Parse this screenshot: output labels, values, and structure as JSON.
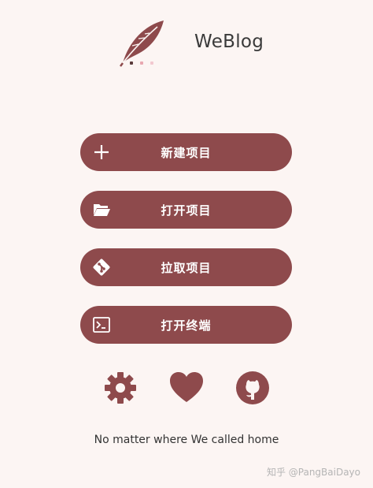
{
  "app": {
    "title": "WeBlog"
  },
  "buttons": {
    "new_project": "新建项目",
    "open_project": "打开项目",
    "pull_project": "拉取项目",
    "open_terminal": "打开终端"
  },
  "tagline": "No matter where We called home",
  "watermark": "知乎 @PangBaiDayo",
  "icons": {
    "logo": "feather-logo",
    "new_project": "plus-icon",
    "open_project": "folder-open-icon",
    "pull_project": "git-icon",
    "open_terminal": "terminal-icon",
    "settings": "gear-icon",
    "favorite": "heart-icon",
    "github": "github-icon"
  },
  "colors": {
    "accent": "#8e4a4c",
    "background": "#fcf5f3",
    "dot_1": "#5a3a3a",
    "dot_2": "#e8a7b0",
    "dot_3": "#f2c8cf"
  }
}
